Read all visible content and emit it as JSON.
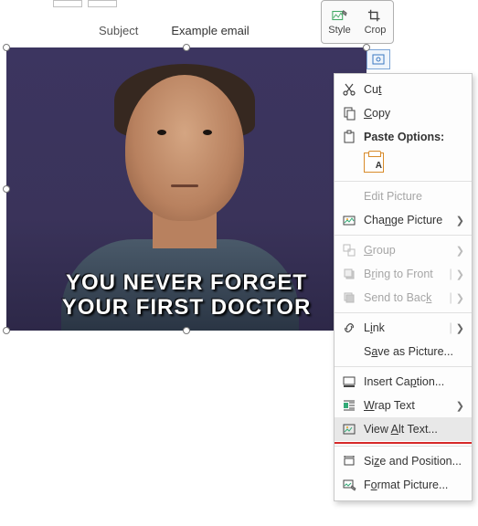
{
  "header": {
    "subject": "Subject",
    "example": "Example email"
  },
  "floater": {
    "style": "Style",
    "crop": "Crop"
  },
  "image": {
    "caption": "YOU NEVER FORGET\nYOUR FIRST DOCTOR"
  },
  "menu": {
    "cut": "Cut",
    "copy": "Copy",
    "paste_options": "Paste Options:",
    "paste_glyph": "A",
    "edit_picture": "Edit Picture",
    "change_picture": "Change Picture",
    "group": "Group",
    "bring_front": "Bring to Front",
    "send_back": "Send to Back",
    "link": "Link",
    "save_as_picture": "Save as Picture...",
    "insert_caption": "Insert Caption...",
    "wrap_text": "Wrap Text",
    "view_alt_text": "View Alt Text...",
    "size_position": "Size and Position...",
    "format_picture": "Format Picture..."
  }
}
